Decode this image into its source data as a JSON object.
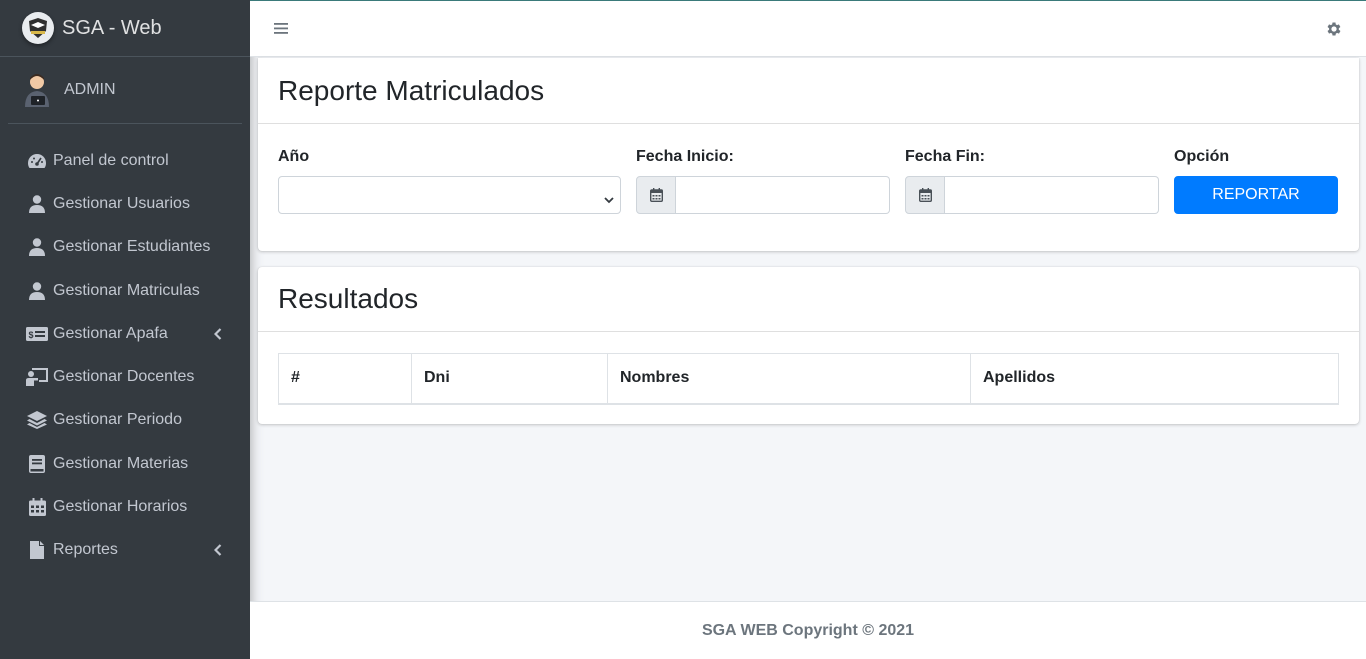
{
  "brand": {
    "name": "SGA - Web",
    "logo_icon": "graduation-crest-icon"
  },
  "user": {
    "name": "ADMIN",
    "avatar_icon": "user-laptop-avatar-icon"
  },
  "sidebar": {
    "items": [
      {
        "label": "Panel de control",
        "icon": "tachometer-icon"
      },
      {
        "label": "Gestionar Usuarios",
        "icon": "user-icon"
      },
      {
        "label": "Gestionar Estudiantes",
        "icon": "user-icon"
      },
      {
        "label": "Gestionar Matriculas",
        "icon": "user-icon"
      },
      {
        "label": "Gestionar Apafa",
        "icon": "money-bill-icon",
        "has_submenu": true
      },
      {
        "label": "Gestionar Docentes",
        "icon": "chalkboard-teacher-icon"
      },
      {
        "label": "Gestionar Periodo",
        "icon": "layer-group-icon"
      },
      {
        "label": "Gestionar Materias",
        "icon": "book-icon"
      },
      {
        "label": "Gestionar Horarios",
        "icon": "calendar-icon"
      },
      {
        "label": "Reportes",
        "icon": "file-icon",
        "has_submenu": true
      }
    ]
  },
  "topbar": {
    "menu_icon": "hamburger-icon",
    "settings_icon": "gear-icon"
  },
  "report_card": {
    "title": "Reporte Matriculados",
    "year_label": "Año",
    "year_value": "",
    "start_label": "Fecha Inicio:",
    "start_value": "",
    "end_label": "Fecha Fin:",
    "end_value": "",
    "option_label": "Opción",
    "report_button": "REPORTAR"
  },
  "results_card": {
    "title": "Resultados",
    "columns": [
      "#",
      "Dni",
      "Nombres",
      "Apellidos"
    ],
    "rows": []
  },
  "footer": {
    "text": "SGA WEB Copyright © 2021"
  },
  "colors": {
    "sidebar_bg": "#343a40",
    "primary": "#007bff",
    "content_bg": "#f4f6f9"
  }
}
